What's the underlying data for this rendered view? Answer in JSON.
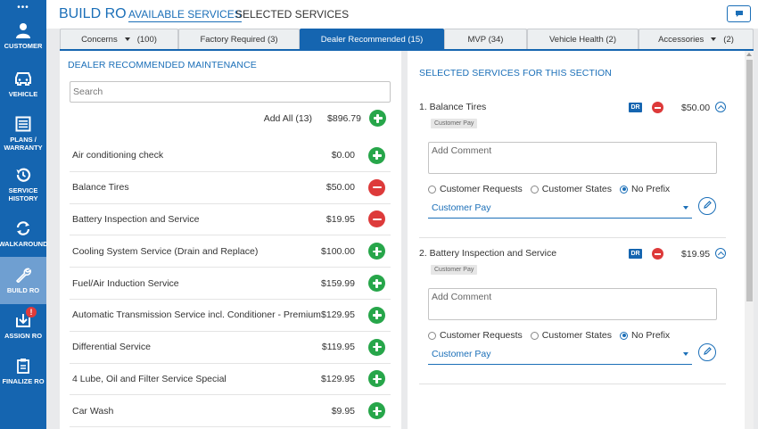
{
  "sidebar": {
    "top_glyph": "•••",
    "items": [
      {
        "label": "CUSTOMER",
        "icon": "user-icon"
      },
      {
        "label": "VEHICLE",
        "icon": "car-icon"
      },
      {
        "label": "PLANS / WARRANTY",
        "icon": "document-list-icon"
      },
      {
        "label": "SERVICE HISTORY",
        "icon": "history-icon"
      },
      {
        "label": "WALKAROUND",
        "icon": "arrows-cycle-icon"
      },
      {
        "label": "BUILD RO",
        "icon": "wrench-icon",
        "active": true
      },
      {
        "label": "ASSIGN RO",
        "icon": "download-tray-icon",
        "badge": "!"
      },
      {
        "label": "FINALIZE RO",
        "icon": "clipboard-icon"
      }
    ]
  },
  "header": {
    "title": "BUILD RO",
    "tabs": [
      {
        "label": "AVAILABLE SERVICES",
        "active": true
      },
      {
        "label": "SELECTED SERVICES",
        "active": false
      }
    ],
    "chat_icon": "chat-bubble-icon"
  },
  "filter_tabs": [
    {
      "label": "Concerns",
      "count": "(100)",
      "dropdown": true
    },
    {
      "label": "Factory Required (3)"
    },
    {
      "label": "Dealer Recommended (15)",
      "active": true
    },
    {
      "label": "MVP (34)"
    },
    {
      "label": "Vehicle Health (2)"
    },
    {
      "label": "Accessories",
      "count": "(2)",
      "dropdown": true
    }
  ],
  "left_panel": {
    "heading": "DEALER RECOMMENDED MAINTENANCE",
    "search_placeholder": "Search",
    "add_all_label": "Add All (13)",
    "add_all_amount": "$896.79",
    "services": [
      {
        "name": "Air conditioning check",
        "price": "$0.00",
        "action": "add"
      },
      {
        "name": "Balance Tires",
        "price": "$50.00",
        "action": "remove"
      },
      {
        "name": "Battery Inspection and Service",
        "price": "$19.95",
        "action": "remove"
      },
      {
        "name": "Cooling System Service (Drain and Replace)",
        "price": "$100.00",
        "action": "add"
      },
      {
        "name": "Fuel/Air Induction Service",
        "price": "$159.99",
        "action": "add"
      },
      {
        "name": "Automatic Transmission Service incl. Conditioner - Premium",
        "price": "$129.95",
        "action": "add"
      },
      {
        "name": "Differential Service",
        "price": "$119.95",
        "action": "add"
      },
      {
        "name": "4 Lube, Oil and Filter Service Special",
        "price": "$129.95",
        "action": "add"
      },
      {
        "name": "Car Wash",
        "price": "$9.95",
        "action": "add"
      }
    ]
  },
  "right_panel": {
    "heading": "SELECTED SERVICES FOR THIS SECTION",
    "selected": [
      {
        "title": "1.  Balance Tires",
        "dr": "DR",
        "price": "$50.00",
        "pay_tag": "Customer Pay",
        "comment_placeholder": "Add Comment",
        "radios": [
          "Customer Requests",
          "Customer States",
          "No Prefix"
        ],
        "selected_radio": "No Prefix",
        "pay_type": "Customer Pay"
      },
      {
        "title": "2.  Battery Inspection and Service",
        "dr": "DR",
        "price": "$19.95",
        "pay_tag": "Customer Pay",
        "comment_placeholder": "Add Comment",
        "radios": [
          "Customer Requests",
          "Customer States",
          "No Prefix"
        ],
        "selected_radio": "No Prefix",
        "pay_type": "Customer Pay"
      }
    ]
  },
  "colors": {
    "primary": "#1565b0",
    "add": "#27a64a",
    "remove": "#dd3a3a"
  }
}
